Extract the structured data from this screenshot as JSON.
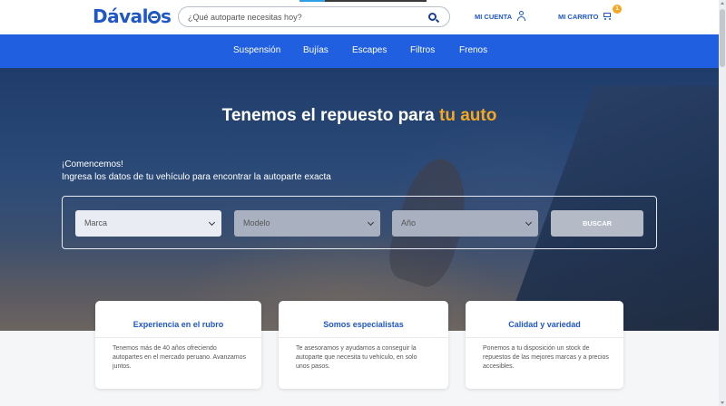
{
  "header": {
    "logo": {
      "prefix": "Dával",
      "suffix": "s"
    },
    "search": {
      "placeholder": "¿Qué autoparte necesitas hoy?"
    },
    "account_label": "MI CUENTA",
    "cart_label": "MI CARRITO",
    "cart_count": "1"
  },
  "nav": {
    "items": [
      "Suspensión",
      "Bujías",
      "Escapes",
      "Filtros",
      "Frenos"
    ]
  },
  "hero": {
    "title_main": "Tenemos el repuesto para ",
    "title_highlight": "tu auto",
    "intro_line1": "¡Comencemos!",
    "intro_line2": "Ingresa los datos de tu vehículo para encontrar la autoparte exacta",
    "highlight_color": "#f5a623"
  },
  "finder": {
    "brand": "Marca",
    "model": "Modelo",
    "year": "Año",
    "search_button": "BUSCAR"
  },
  "features": [
    {
      "title": "Experiencia en el rubro",
      "text": "Tenemos más de 40 años ofreciendo autopartes en el mercado peruano. Avanzamos juntos."
    },
    {
      "title": "Somos especialistas",
      "text": "Te asesoramos y ayudamos a conseguir la autoparte que necesita tu vehículo, en solo unos pasos."
    },
    {
      "title": "Calidad y variedad",
      "text": "Ponemos a tu disposición un stock de repuestos de las mejores marcas y a precios accesibles."
    }
  ],
  "colors": {
    "brand": "#1f57c7",
    "nav": "#1f5fe0",
    "accent": "#f5a623"
  }
}
